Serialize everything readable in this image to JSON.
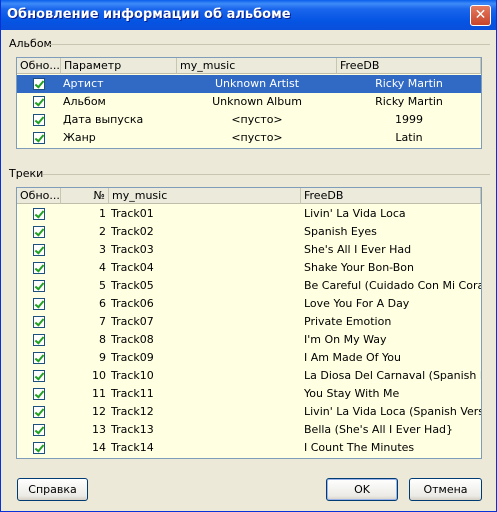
{
  "window": {
    "title": "Обновление информации об альбоме",
    "close_glyph": "✕"
  },
  "album_group": {
    "label": "Альбом"
  },
  "album_table": {
    "headers": [
      "Обно...",
      "Параметр",
      "my_music",
      "FreeDB"
    ],
    "rows": [
      {
        "param": "Артист",
        "my_music": "Unknown Artist",
        "freedb": "Ricky Martin",
        "checked": true,
        "selected": true
      },
      {
        "param": "Альбом",
        "my_music": "Unknown Album",
        "freedb": "Ricky Martin",
        "checked": true,
        "selected": false
      },
      {
        "param": "Дата выпуска",
        "my_music": "<пусто>",
        "freedb": "1999",
        "checked": true,
        "selected": false
      },
      {
        "param": "Жанр",
        "my_music": "<пусто>",
        "freedb": "Latin",
        "checked": true,
        "selected": false
      }
    ]
  },
  "tracks_group": {
    "label": "Треки"
  },
  "tracks_table": {
    "headers": [
      "Обно...",
      "№",
      "my_music",
      "FreeDB"
    ],
    "rows": [
      {
        "num": "1",
        "my_music": "Track01",
        "freedb": "Livin' La Vida Loca",
        "checked": true
      },
      {
        "num": "2",
        "my_music": "Track02",
        "freedb": "Spanish Eyes",
        "checked": true
      },
      {
        "num": "3",
        "my_music": "Track03",
        "freedb": "She's All I Ever Had",
        "checked": true
      },
      {
        "num": "4",
        "my_music": "Track04",
        "freedb": "Shake Your Bon-Bon",
        "checked": true
      },
      {
        "num": "5",
        "my_music": "Track05",
        "freedb": "Be Careful (Cuidado Con Mi Corazyn)",
        "checked": true
      },
      {
        "num": "6",
        "my_music": "Track06",
        "freedb": "Love You For A Day",
        "checked": true
      },
      {
        "num": "7",
        "my_music": "Track07",
        "freedb": "Private Emotion",
        "checked": true
      },
      {
        "num": "8",
        "my_music": "Track08",
        "freedb": "I'm On My Way",
        "checked": true
      },
      {
        "num": "9",
        "my_music": "Track09",
        "freedb": "I Am Made Of You",
        "checked": true
      },
      {
        "num": "10",
        "my_music": "Track10",
        "freedb": "La Diosa Del Carnaval (Spanish Eyes)",
        "checked": true
      },
      {
        "num": "11",
        "my_music": "Track11",
        "freedb": "You Stay With Me",
        "checked": true
      },
      {
        "num": "12",
        "my_music": "Track12",
        "freedb": "Livin' La Vida Loca (Spanish Version)",
        "checked": true
      },
      {
        "num": "13",
        "my_music": "Track13",
        "freedb": "Bella (She's All I Ever Had}",
        "checked": true
      },
      {
        "num": "14",
        "my_music": "Track14",
        "freedb": "I Count The Minutes",
        "checked": true
      }
    ]
  },
  "buttons": {
    "help": "Справка",
    "ok": "OK",
    "cancel": "Отмена"
  }
}
